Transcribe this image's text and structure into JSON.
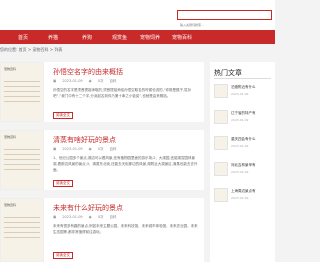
{
  "search": {
    "placeholder": "输入关键词搜索..."
  },
  "nav": {
    "items": [
      "首页",
      "养猫",
      "养狗",
      "观赏鱼",
      "宠物饲养",
      "宠物百科"
    ]
  },
  "breadcrumb": "您的位置: 首页 > 宠物百科 > 列表",
  "articles": [
    {
      "thumb_caption": "宠物百科",
      "title": "孙悟空名字的由来概括",
      "date": "2023-01-09",
      "views": "0次",
      "category": "百科",
      "excerpt": "孙悟空的名字是须菩提祖师取的,须菩提祖师给孙悟空取名的时候也说的,“你既是猴子,姓孙吧”,“我门中有十二个字,分派起名到你乃第十辈之小徒矣”,也就是由来概括。",
      "more": "阅读全文"
    },
    {
      "thumb_caption": "宠物百科",
      "title": "清蒸有啥好玩的景点",
      "date": "2023-01-09",
      "views": "0次",
      "category": "百科",
      "excerpt": "1、世纪公园多个景点,湖边可以看风景,还有植物园里面的游乐场;2、大观园,还能观赏园林景观,看那边风景的景点;3、清蒸东北街,还能去天街那边的风景,湖附近大观景区,清蒸也能去去外面。",
      "more": "阅读全文"
    },
    {
      "thumb_caption": "宠物百科",
      "title": "未来有什么好玩的景点",
      "date": "2023-01-09",
      "views": "0次",
      "category": "百科",
      "excerpt": "未来有很多有趣的景点,例如未来主题公园、未来科技馆、未来城市体验馆、未来农业园、未来生态园等,都非常值得前往游玩。",
      "more": "阅读全文"
    }
  ],
  "sidebar": {
    "heading": "热门文章",
    "items": [
      {
        "title": "泊渡附近有什么",
        "date": "2023-01-09"
      },
      {
        "title": "辽宁省的特产有",
        "date": "2023-01-09"
      },
      {
        "title": "重庆四会有什么",
        "date": "2023-01-09"
      },
      {
        "title": "河北吉林景甲有",
        "date": "2023-01-09"
      },
      {
        "title": "上海周边景点有",
        "date": "2023-01-09"
      }
    ]
  },
  "colors": {
    "accent": "#c72a28",
    "background": "#f3f3f3"
  }
}
